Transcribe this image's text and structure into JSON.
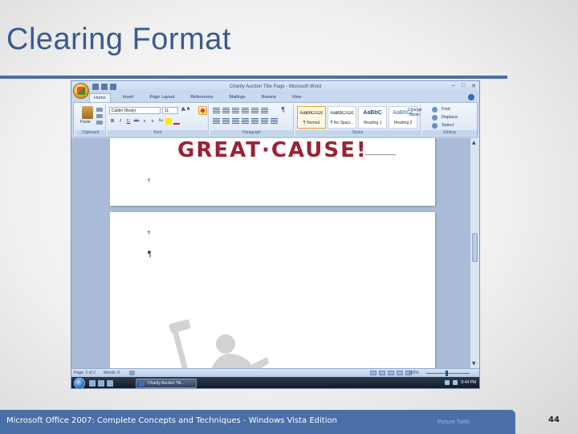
{
  "slide": {
    "title": "Clearing Format",
    "footer": "Microsoft Office 2007: Complete Concepts and Techniques - Windows Vista Edition",
    "footer_ghost": "Picture Tools",
    "number": "44"
  },
  "colors": {
    "title": "#3b5a8c",
    "rule": "#4a6fa6",
    "great_cause": "#9c2136"
  },
  "word": {
    "window_title": "Charity Auction Title Page - Microsoft Word",
    "tabs": [
      "Home",
      "Insert",
      "Page Layout",
      "References",
      "Mailings",
      "Review",
      "View"
    ],
    "active_tab": "Home",
    "ribbon": {
      "clipboard": {
        "label": "Clipboard",
        "paste": "Paste"
      },
      "font": {
        "label": "Font",
        "font_name": "Calibri (Body)",
        "font_size": "11",
        "grow": "A",
        "shrink": "A",
        "buttons": [
          "B",
          "I",
          "U",
          "abc",
          "x",
          "x",
          "Aa"
        ]
      },
      "paragraph": {
        "label": "Paragraph",
        "pilcrow": "¶"
      },
      "styles": {
        "label": "Styles",
        "gallery": [
          {
            "sample": "AaBbCcDc",
            "name": "¶ Normal"
          },
          {
            "sample": "AaBbCcDc",
            "name": "¶ No Spaci..."
          },
          {
            "sample": "AaBbC",
            "name": "Heading 1"
          },
          {
            "sample": "AaBbCc",
            "name": "Heading 2"
          }
        ],
        "change_styles": "Change Styles"
      },
      "editing": {
        "label": "Editing",
        "find": "Find",
        "replace": "Replace",
        "select": "Select"
      }
    },
    "document": {
      "heading": "GREAT·CAUSE!",
      "pilcrow": "¶"
    },
    "status": {
      "page": "Page: 2 of 2",
      "words": "Words: 8",
      "zoom": "100%"
    },
    "taskbar": {
      "task_label": "Charity Auction Titl...",
      "clock": "8:44 PM"
    }
  }
}
